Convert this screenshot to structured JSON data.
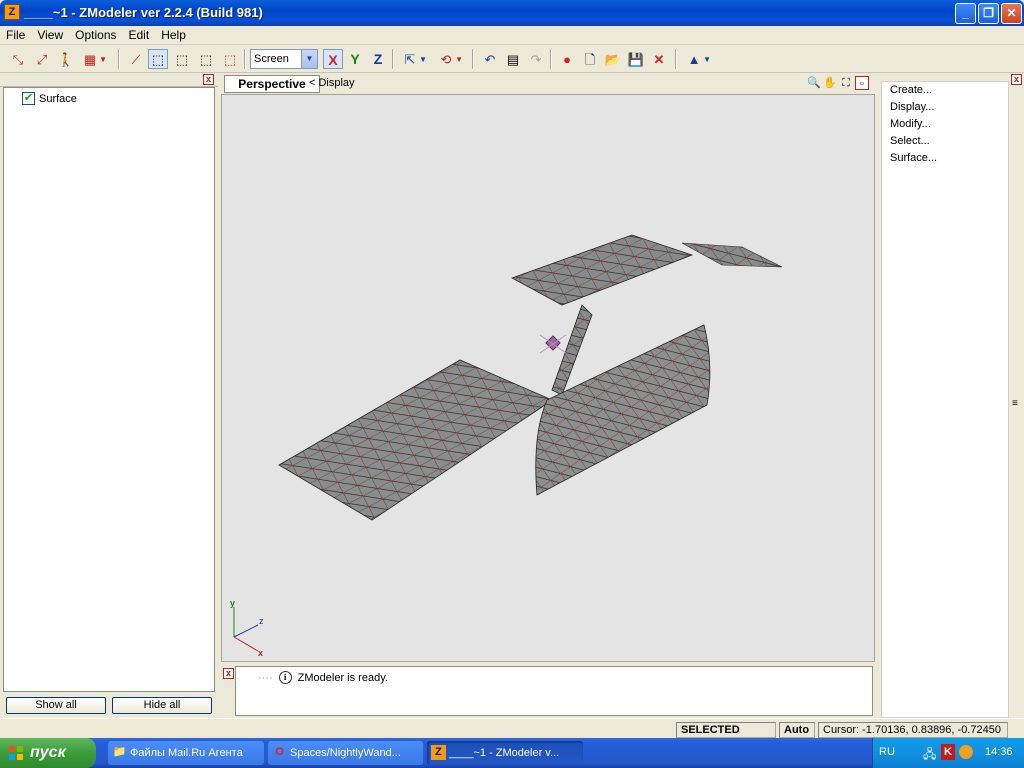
{
  "window": {
    "title": "____~1 - ZModeler ver 2.2.4 (Build 981)",
    "app_icon_letter": "Z"
  },
  "menu": [
    {
      "label": "File"
    },
    {
      "label": "View"
    },
    {
      "label": "Options"
    },
    {
      "label": "Edit"
    },
    {
      "label": "Help"
    }
  ],
  "toolbar": {
    "coord_system": "Screen",
    "axis_x": "X",
    "axis_y": "Y",
    "axis_z": "Z",
    "colors": {
      "axis_x": "#cc2020",
      "axis_y": "#208020",
      "axis_z": "#2030a0"
    }
  },
  "objects_panel": {
    "items": [
      {
        "label": "Surface",
        "checked": true
      }
    ],
    "show_all": "Show all",
    "hide_all": "Hide all"
  },
  "viewport": {
    "tab": "Perspective",
    "display_label": "< Display",
    "gizmo": {
      "y": "y",
      "z": "z",
      "x": "x"
    }
  },
  "commands": [
    "Create...",
    "Display...",
    "Modify...",
    "Select...",
    "Surface..."
  ],
  "log": {
    "message": "ZModeler is ready."
  },
  "status": {
    "mode": "SELECTED MODE",
    "auto": "Auto",
    "cursor": "Cursor: -1.70136, 0.83896, -0.72450"
  },
  "taskbar": {
    "start": "пуск",
    "tasks": [
      {
        "label": "Файлы Mail.Ru Агента",
        "icon": "folder-icon"
      },
      {
        "label": "Spaces/NightlyWand...",
        "icon": "opera-icon"
      },
      {
        "label": "____~1 - ZModeler v...",
        "icon": "zmodeler-icon",
        "active": true
      }
    ],
    "lang": "RU",
    "clock": "14:36"
  }
}
